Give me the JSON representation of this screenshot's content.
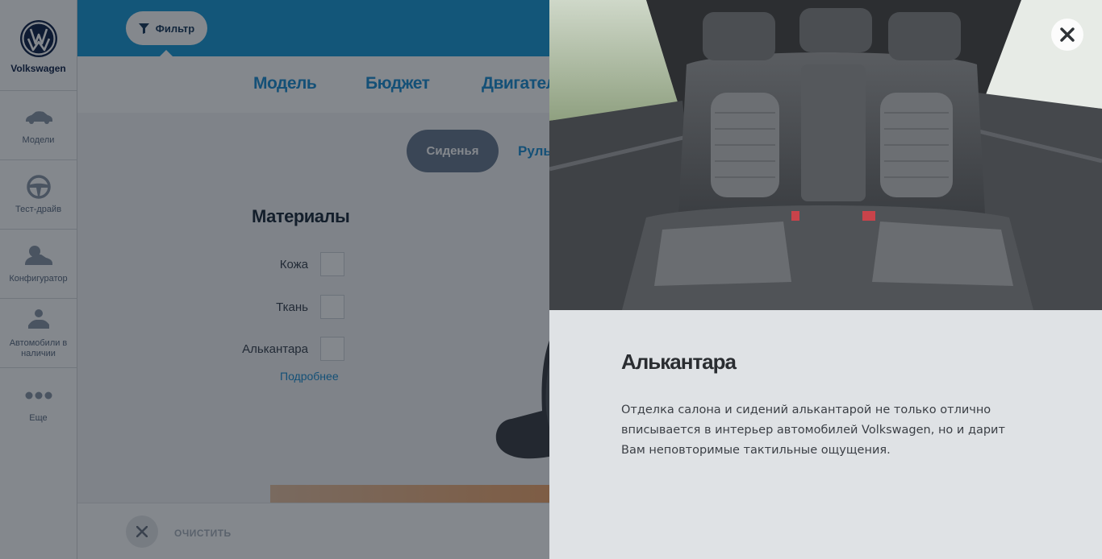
{
  "sidebar": {
    "brand": "Volkswagen",
    "items": [
      {
        "label": "Модели",
        "icon": "car-icon"
      },
      {
        "label": "Тест-драйв",
        "icon": "steering-wheel-icon"
      },
      {
        "label": "Конфигуратор",
        "icon": "configurator-icon"
      },
      {
        "label": "Автомобили в наличии",
        "icon": "car-stock-icon"
      },
      {
        "label": "Еще",
        "icon": "more-dots-icon"
      }
    ]
  },
  "header": {
    "filter_label": "Фильтр"
  },
  "tabs": [
    "Модель",
    "Бюджет",
    "Двигатель"
  ],
  "subtabs": {
    "active": "Сиденья",
    "next": "Руль"
  },
  "materials": {
    "title": "Материалы",
    "options": [
      "Кожа",
      "Ткань",
      "Алькантара"
    ],
    "more_link": "Подробнее"
  },
  "footer": {
    "clear_label": "ОЧИСТИТЬ"
  },
  "modal": {
    "title": "Алькантара",
    "description": "Отделка салона и сидений алькантарой не только отлично вписывается в интерьер автомобилей Volkswagen, но и дарит Вам неповторимые тактильные ощущения.",
    "image_subject": "rear seats with Alcantara inserts"
  },
  "colors": {
    "accent_blue": "#1d9ad6",
    "link_blue": "#1e8fd3",
    "panel_bg": "#dfe2e5",
    "vw_navy": "#13254a"
  }
}
